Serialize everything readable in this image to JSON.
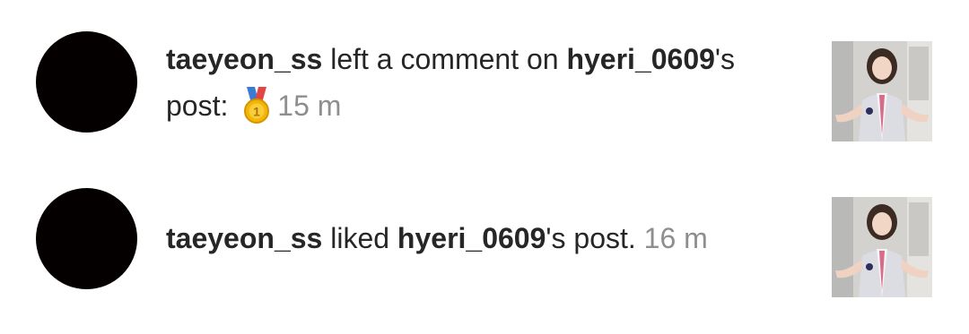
{
  "notifications": [
    {
      "username": "taeyeon_ss",
      "action": " left a comment on ",
      "target": "hyeri_0609",
      "suffix": "'s post: ",
      "emoji": "🥇",
      "emoji_icon": "first-place-medal-icon",
      "time": "15 m"
    },
    {
      "username": "taeyeon_ss",
      "action": " liked ",
      "target": "hyeri_0609",
      "suffix": "'s post. ",
      "time": "16 m"
    }
  ],
  "colors": {
    "text": "#262626",
    "muted": "#8e8e8e",
    "avatar": "#050000",
    "medal_gold": "#f2b705",
    "medal_ribbon": "#3a7bd5"
  }
}
